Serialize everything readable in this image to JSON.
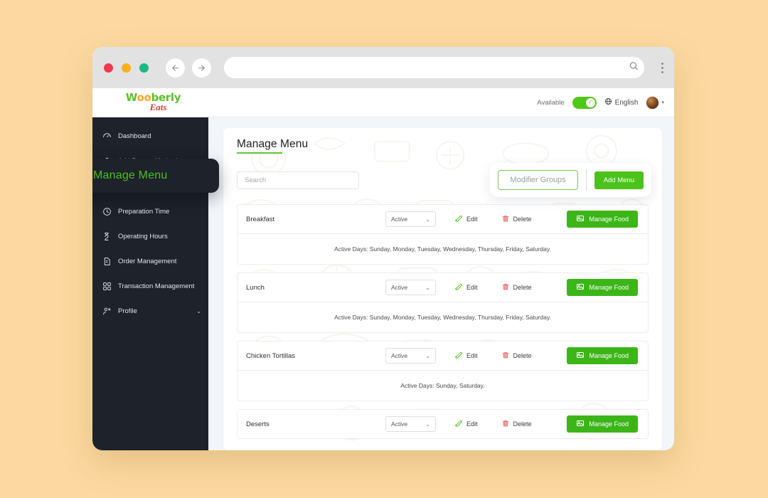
{
  "browser": {
    "traffic_lights": [
      "close",
      "minimize",
      "maximize"
    ],
    "back_icon": "←",
    "forward_icon": "→",
    "url_value": "",
    "url_placeholder": "",
    "search_icon": "search-icon",
    "menu_icon": "kebab-menu-icon"
  },
  "header": {
    "logo_part1": "W",
    "logo_oo": "oo",
    "logo_part2": "berly",
    "logo_sub": "Eats",
    "availability_label": "Available",
    "availability_on": true,
    "toggle_check": "✓",
    "language_icon": "globe-icon",
    "language": "English",
    "avatar_caret": "▾"
  },
  "sidebar": {
    "items": [
      {
        "label": "Dashboard",
        "icon": "dashboard-icon",
        "active": false
      },
      {
        "label": "Add Payout Method",
        "icon": "wallet-icon",
        "active": false
      },
      {
        "label": "Preparation Time",
        "icon": "clock-icon",
        "active": false
      },
      {
        "label": "Operating Hours",
        "icon": "hourglass-icon",
        "active": false
      },
      {
        "label": "Order Management",
        "icon": "order-doc-icon",
        "active": false
      },
      {
        "label": "Transaction Management",
        "icon": "transaction-grid-icon",
        "active": false
      },
      {
        "label": "Profile",
        "icon": "profile-icon",
        "active": false,
        "chevron": "⌄"
      }
    ],
    "callout": {
      "label": "Manage Menu",
      "icon": "list-menu-icon",
      "color": "#49c01c"
    }
  },
  "main": {
    "title": "Manage Menu",
    "search_placeholder": "Search",
    "search_value": "",
    "modifier_groups_label": "Modifier Groups",
    "add_menu_label": "Add Menu",
    "row_actions": {
      "edit_label": "Edit",
      "edit_icon": "pencil-edit-icon",
      "delete_label": "Delete",
      "delete_icon": "trash-delete-icon",
      "manage_food_label": "Manage Food",
      "manage_food_icon": "image-food-icon",
      "status_chevron": "⌄"
    },
    "menus": [
      {
        "name": "Breakfast",
        "status": "Active",
        "active_days": "Active Days: Sunday, Monday, Tuesday, Wednesday, Thursday, Friday, Saturday.",
        "show_days": true
      },
      {
        "name": "Lunch",
        "status": "Active",
        "active_days": "Active Days: Sunday, Monday, Tuesday, Wednesday, Thursday, Friday, Saturday.",
        "show_days": true
      },
      {
        "name": "Chicken Tortillas",
        "status": "Active",
        "active_days": "Active Days: Sunday, Saturday.",
        "show_days": true
      },
      {
        "name": "Deserts",
        "status": "Active",
        "active_days": "",
        "show_days": false
      }
    ]
  },
  "colors": {
    "page_background": "#fbd9a0",
    "sidebar": "#1d222b",
    "accent_green": "#4cc31b",
    "manage_food_green": "#3cb518",
    "delete_red": "#ef6b6b",
    "content_bg": "#f2f6fa"
  }
}
